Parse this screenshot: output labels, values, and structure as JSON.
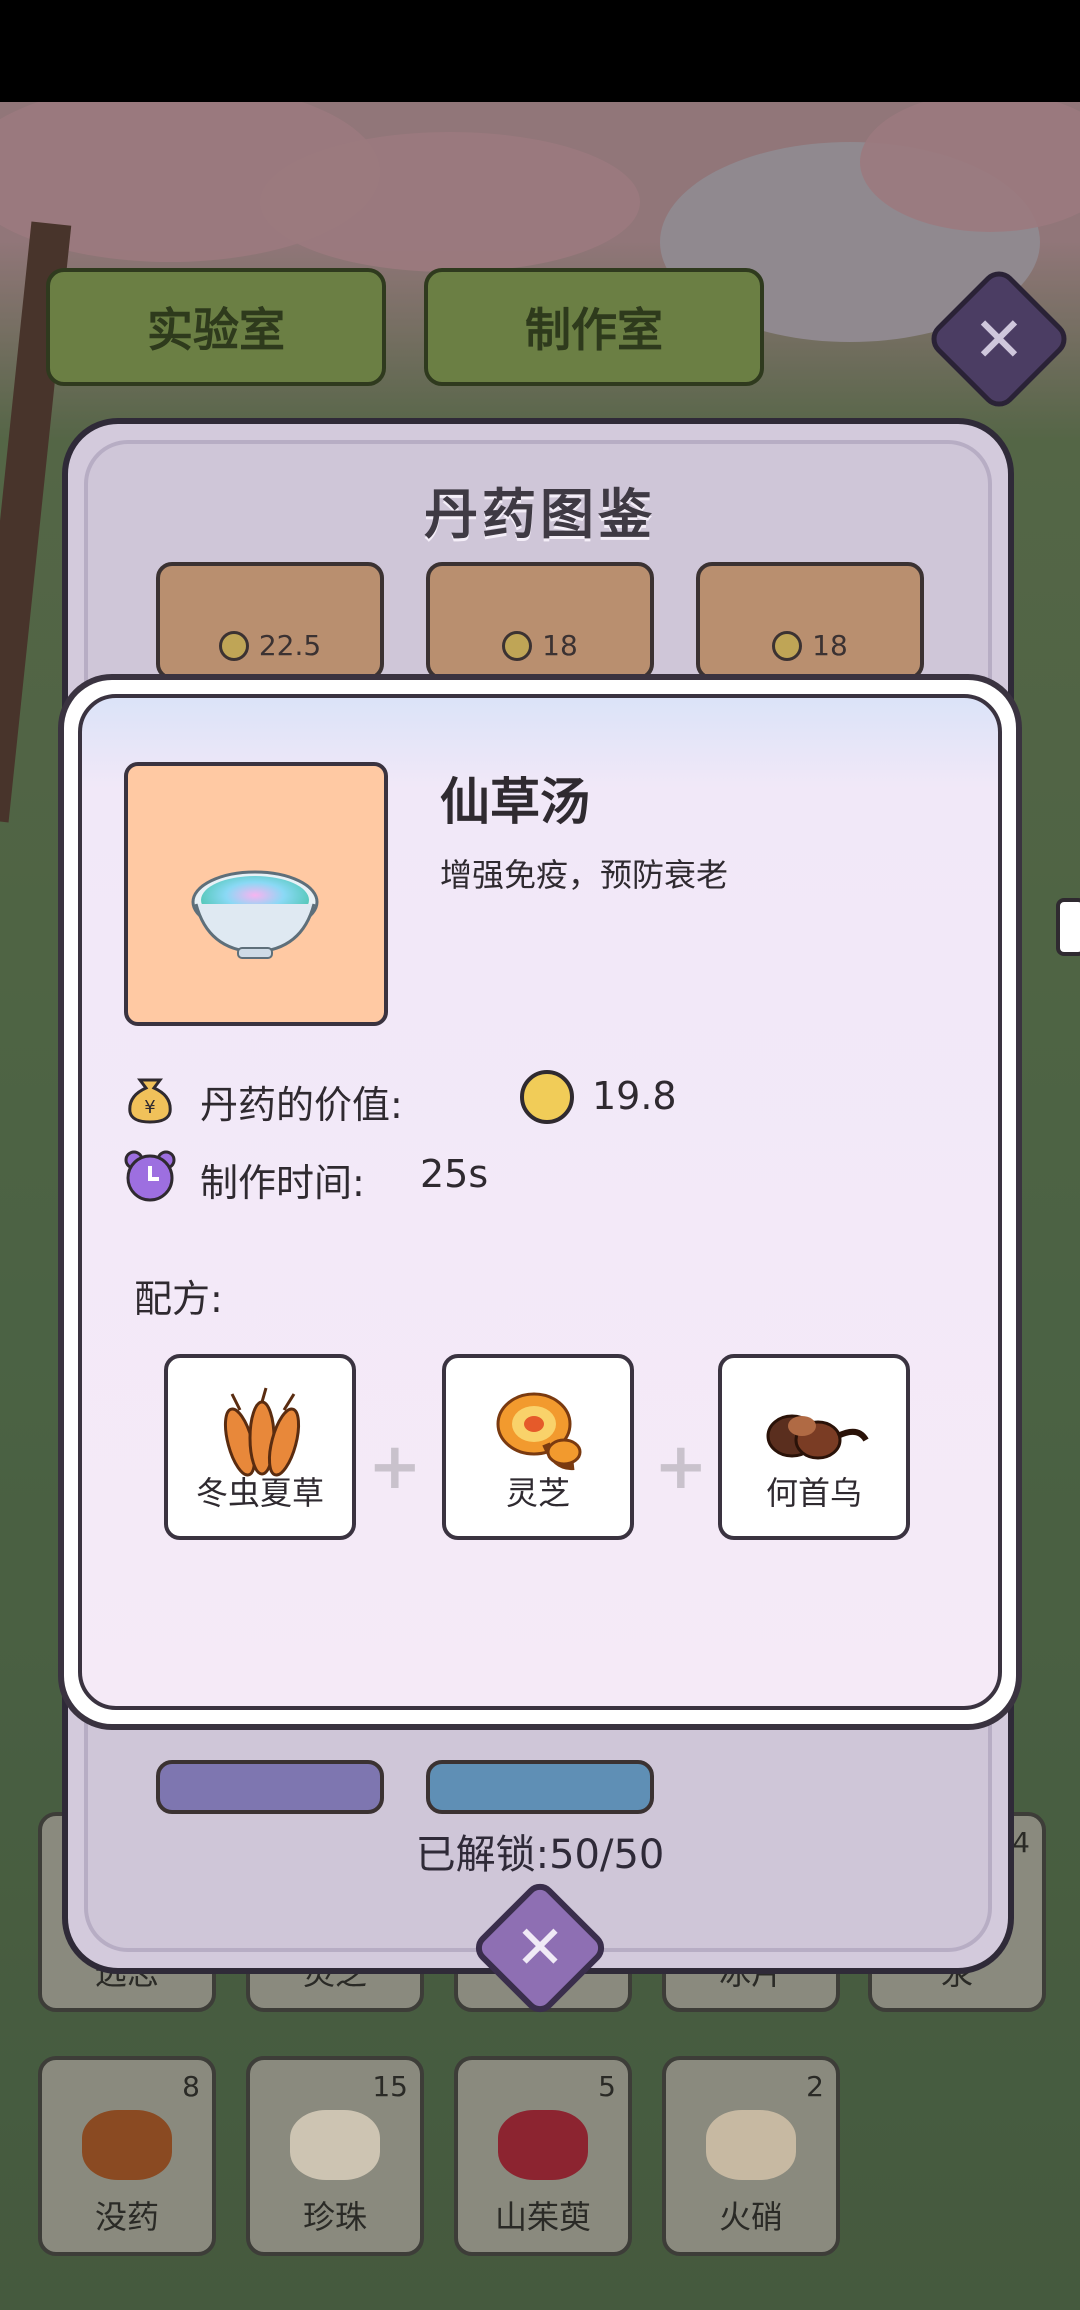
{
  "top_tabs": {
    "lab": "实验室",
    "workshop": "制作室"
  },
  "encyclopedia": {
    "title": "丹药图鉴",
    "visible_prices": [
      "22.5",
      "18",
      "18"
    ],
    "unlocked_label": "已解锁:50/50"
  },
  "detail": {
    "name": "仙草汤",
    "description": "增强免疫，预防衰老",
    "value_label": "丹药的价值:",
    "value": "19.8",
    "time_label": "制作时间:",
    "time": "25s",
    "recipe_label": "配方:",
    "ingredients": [
      {
        "name": "冬虫夏草",
        "icon": "cordyceps-icon"
      },
      {
        "name": "灵芝",
        "icon": "lingzhi-icon"
      },
      {
        "name": "何首乌",
        "icon": "heshouwu-icon"
      }
    ]
  },
  "inventory": {
    "row1": [
      {
        "name": "远志",
        "count": ""
      },
      {
        "name": "灵芝",
        "count": ""
      },
      {
        "name": "",
        "count": ""
      },
      {
        "name": "冰片",
        "count": ""
      },
      {
        "name": "汞",
        "count": "4"
      }
    ],
    "row2": [
      {
        "name": "没药",
        "count": "8"
      },
      {
        "name": "珍珠",
        "count": "15"
      },
      {
        "name": "山茱萸",
        "count": "5"
      },
      {
        "name": "火硝",
        "count": "2"
      }
    ]
  },
  "colors": {
    "panel": "#d3cadc",
    "thumb_bg": "#ffc9a3",
    "coin": "#f1cc58",
    "close_button": "#8e6fb3"
  }
}
